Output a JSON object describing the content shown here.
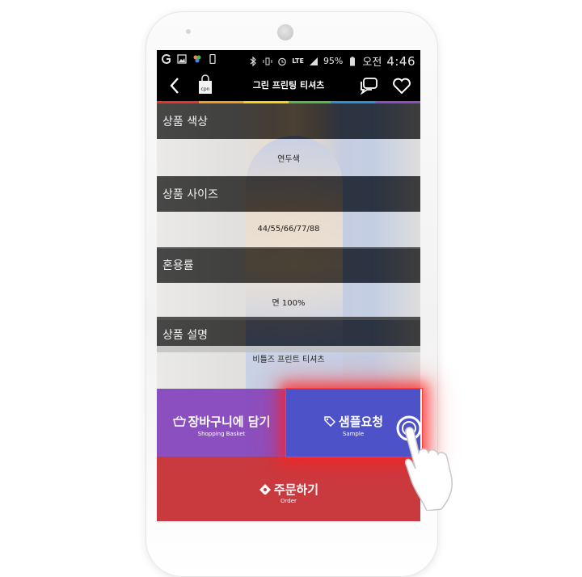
{
  "status_bar": {
    "battery_percent": "95%",
    "am_pm": "오전",
    "time": "4:46",
    "network": "LTE"
  },
  "app_bar": {
    "title": "그린 프린팅 티셔츠",
    "bag_label": "cpn"
  },
  "details": [
    {
      "label": "상품 색상",
      "value": "연두색"
    },
    {
      "label": "상품 사이즈",
      "value": "44/55/66/77/88"
    },
    {
      "label": "혼용률",
      "value": "면 100%"
    },
    {
      "label": "상품 설명",
      "value": "비틀즈 프린트 티셔츠"
    }
  ],
  "actions": {
    "basket": {
      "label": "장바구니에 담기",
      "sub": "Shopping Basket"
    },
    "sample": {
      "label": "샘플요청",
      "sub": "Sample"
    },
    "order": {
      "label": "주문하기",
      "sub": "Order"
    }
  },
  "colors": {
    "basket": "#8b4fbf",
    "sample": "#4d52c8",
    "order": "#c93a3f",
    "highlight": "#ff3b3b"
  },
  "icons": {
    "back": "chevron-left-icon",
    "bag": "shopping-bag-icon",
    "chat": "chat-bubble-icon",
    "heart": "heart-icon",
    "basket": "basket-icon",
    "sample": "tag-icon",
    "order": "ticket-icon",
    "hand": "pointing-hand-icon"
  }
}
